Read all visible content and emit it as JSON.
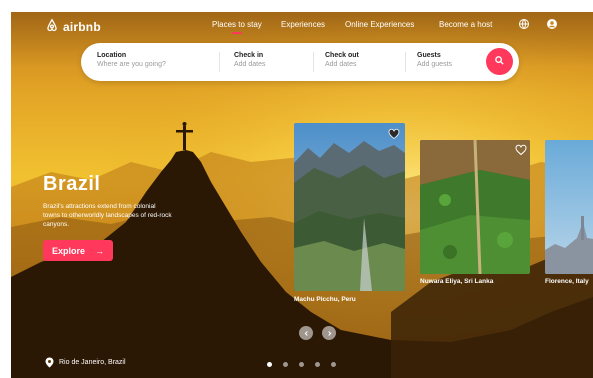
{
  "brand": {
    "name": "airbnb",
    "logo_icon": "airbnb-logo-icon",
    "accent_color": "#ff385c"
  },
  "nav": {
    "links": [
      {
        "label": "Places to stay",
        "active": true
      },
      {
        "label": "Experiences",
        "active": false
      },
      {
        "label": "Online Experiences",
        "active": false
      },
      {
        "label": "Become a host",
        "active": false
      }
    ],
    "icons": [
      "globe-icon",
      "user-icon"
    ]
  },
  "search": {
    "location": {
      "label": "Location",
      "placeholder": "Where are you going?"
    },
    "checkin": {
      "label": "Check in",
      "placeholder": "Add dates"
    },
    "checkout": {
      "label": "Check out",
      "placeholder": "Add dates"
    },
    "guests": {
      "label": "Guests",
      "placeholder": "Add guests"
    },
    "button_icon": "search-icon"
  },
  "hero": {
    "title": "Brazil",
    "description": "Brazil's attractions extend from colonial towns to otherworldly landscapes of red-rock canyons.",
    "cta_label": "Explore",
    "cta_icon": "arrow-right-icon",
    "location": "Rio de Janeiro, Brazil",
    "location_icon": "map-pin-icon"
  },
  "cards": [
    {
      "name": "Machu Picchu, Peru",
      "favorited": true
    },
    {
      "name": "Nuwara Eliya, Sri Lanka",
      "favorited": false
    },
    {
      "name": "Florence, Italy",
      "favorited": false
    }
  ],
  "carousel": {
    "prev_icon": "chevron-left-icon",
    "next_icon": "chevron-right-icon",
    "dots_total": 5,
    "active_dot": 1
  }
}
